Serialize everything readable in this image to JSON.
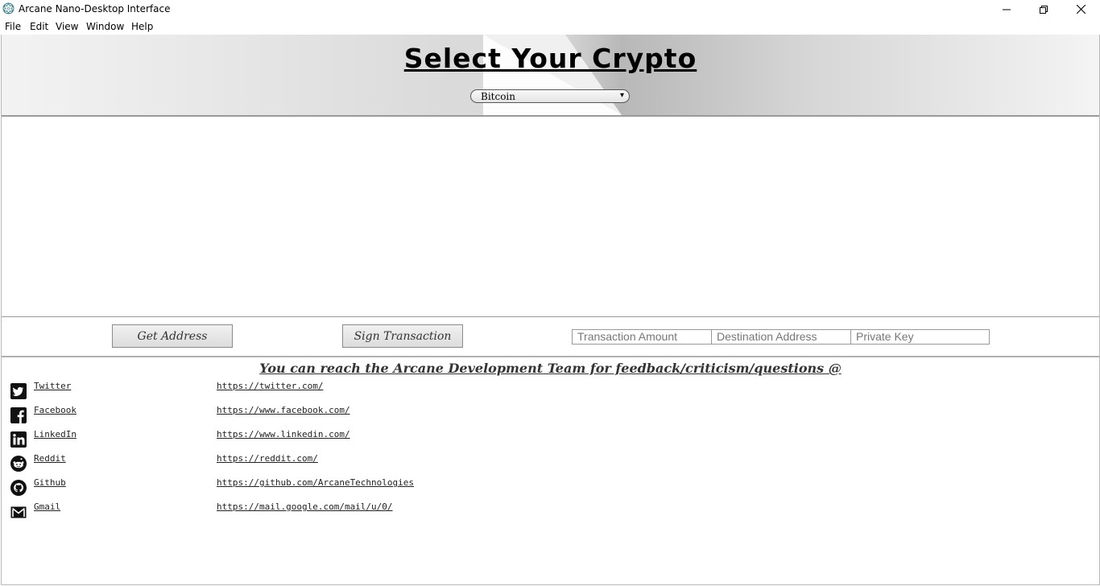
{
  "window": {
    "title": "Arcane Nano-Desktop Interface",
    "icon": "electron-atom-icon"
  },
  "menu": [
    "File",
    "Edit",
    "View",
    "Window",
    "Help"
  ],
  "header": {
    "title": "Select Your Crypto",
    "crypto_select": {
      "selected": "Bitcoin",
      "arrow": "▾"
    }
  },
  "actions": {
    "get_address_label": "Get Address",
    "sign_transaction_label": "Sign Transaction",
    "transaction_amount_placeholder": "Transaction Amount",
    "destination_address_placeholder": "Destination Address",
    "private_key_placeholder": "Private Key"
  },
  "contact": {
    "heading": "You can reach the Arcane Development Team for feedback/criticism/questions @",
    "links": [
      {
        "name": "Twitter",
        "url": "https://twitter.com/",
        "icon": "twitter-icon"
      },
      {
        "name": "Facebook",
        "url": "https://www.facebook.com/",
        "icon": "facebook-icon"
      },
      {
        "name": "LinkedIn",
        "url": "https://www.linkedin.com/",
        "icon": "linkedin-icon"
      },
      {
        "name": "Reddit",
        "url": "https://reddit.com/",
        "icon": "reddit-icon"
      },
      {
        "name": "Github",
        "url": "https://github.com/ArcaneTechnologies",
        "icon": "github-icon"
      },
      {
        "name": "Gmail",
        "url": "https://mail.google.com/mail/u/0/",
        "icon": "gmail-icon"
      }
    ]
  }
}
